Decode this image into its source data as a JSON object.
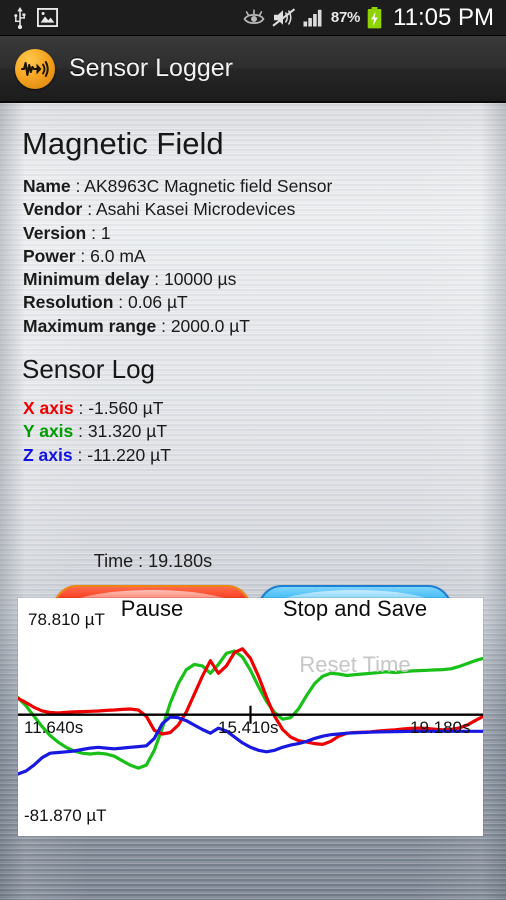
{
  "status_bar": {
    "icons_left": [
      "usb-icon",
      "screenshot-image-icon"
    ],
    "icons_right": [
      "smart-stay-eye-icon",
      "sound-muted-icon",
      "signal-bars-icon"
    ],
    "battery_percent": "87%",
    "battery_state": "charging",
    "clock": "11:05 PM"
  },
  "action_bar": {
    "app_icon": "waveform-signal-icon",
    "title": "Sensor Logger"
  },
  "sensor": {
    "title": "Magnetic Field",
    "specs": [
      {
        "label": "Name",
        "value": "AK8963C Magnetic field Sensor"
      },
      {
        "label": "Vendor",
        "value": "Asahi Kasei Microdevices"
      },
      {
        "label": "Version",
        "value": "1"
      },
      {
        "label": "Power",
        "value": "6.0 mA"
      },
      {
        "label": "Minimum delay",
        "value": "10000 µs"
      },
      {
        "label": "Resolution",
        "value": "0.06 µT"
      },
      {
        "label": "Maximum range",
        "value": "2000.0 µT"
      }
    ]
  },
  "sensor_log": {
    "title": "Sensor Log",
    "axes": [
      {
        "label": "X axis",
        "value": "-1.560 µT",
        "color": "#ee0000"
      },
      {
        "label": "Y axis",
        "value": "31.320 µT",
        "color": "#009b00"
      },
      {
        "label": "Z axis",
        "value": "-11.220 µT",
        "color": "#1212e0"
      }
    ]
  },
  "controls": {
    "pause_label": "Pause",
    "stop_save_label": "Stop and Save",
    "reset_label": "Reset Time",
    "reset_enabled": false,
    "time_label": "Time : 19.180s"
  },
  "chart_data": {
    "type": "line",
    "title": "",
    "xlabel": "",
    "ylabel": "",
    "unit": "µT",
    "grid": false,
    "legend": "none",
    "y_max_label": "78.810 µT",
    "y_min_label": "-81.870 µT",
    "ylim": [
      -81.87,
      78.81
    ],
    "x_tick_labels": [
      "11.640s",
      "15.410s",
      "19.180s"
    ],
    "xlim": [
      11.64,
      19.18
    ],
    "zero_line": true,
    "zero_line_color": "#000000",
    "center_marker": true,
    "series": [
      {
        "name": "X axis",
        "color": "#ee0000",
        "values": [
          11.0,
          8.2,
          5.0,
          2.6,
          1.5,
          1.2,
          1.6,
          2.0,
          2.1,
          2.3,
          2.5,
          2.9,
          3.2,
          3.6,
          3.9,
          3.2,
          -1.0,
          -10.5,
          -13.0,
          -12.0,
          -7.0,
          2.0,
          14.0,
          26.0,
          36.5,
          28.0,
          33.0,
          42.0,
          44.5,
          38.0,
          26.0,
          12.0,
          -1.0,
          -10.0,
          -15.0,
          -17.5,
          -18.5,
          -19.5,
          -20.0,
          -18.0,
          -14.5,
          -12.5,
          -12.0,
          -11.8,
          -11.5,
          -11.0,
          -10.6,
          -10.2,
          -9.6,
          -9.2,
          -9.0,
          -9.3,
          -9.8,
          -10.2,
          -10.0,
          -9.0,
          -7.0,
          -4.0,
          -1.2
        ]
      },
      {
        "name": "Y axis",
        "color": "#18c018",
        "values": [
          11.5,
          6.0,
          -1.0,
          -8.0,
          -14.0,
          -18.5,
          -22.0,
          -24.5,
          -26.0,
          -26.5,
          -26.0,
          -26.5,
          -28.0,
          -31.0,
          -34.0,
          -36.0,
          -34.0,
          -24.0,
          -9.0,
          8.0,
          21.0,
          30.5,
          34.0,
          33.0,
          28.0,
          34.0,
          41.5,
          43.0,
          39.0,
          30.0,
          19.0,
          9.0,
          1.5,
          -3.0,
          -2.0,
          4.0,
          13.0,
          21.0,
          26.0,
          28.0,
          27.5,
          26.5,
          27.0,
          27.5,
          28.0,
          28.5,
          29.0,
          28.5,
          29.0,
          29.5,
          29.8,
          30.0,
          30.3,
          30.5,
          31.0,
          32.5,
          34.5,
          36.5,
          38.0
        ]
      },
      {
        "name": "Z axis",
        "color": "#1818e0",
        "values": [
          -40.0,
          -38.0,
          -34.0,
          -29.0,
          -26.0,
          -25.5,
          -25.0,
          -24.5,
          -23.5,
          -22.5,
          -22.0,
          -22.5,
          -23.0,
          -22.5,
          -22.0,
          -21.5,
          -21.0,
          -16.0,
          -6.0,
          -1.5,
          -2.0,
          -4.0,
          -7.0,
          -10.0,
          -12.5,
          -9.0,
          -11.0,
          -15.0,
          -19.0,
          -22.0,
          -24.0,
          -25.0,
          -24.0,
          -22.0,
          -20.5,
          -19.5,
          -18.0,
          -16.0,
          -14.5,
          -13.5,
          -13.0,
          -12.5,
          -12.2,
          -12.0,
          -11.8,
          -11.6,
          -11.5,
          -11.4,
          -11.3,
          -11.2,
          -11.2,
          -11.2,
          -11.2,
          -11.2,
          -11.2,
          -11.2,
          -11.2,
          -11.2,
          -11.2
        ]
      }
    ]
  }
}
